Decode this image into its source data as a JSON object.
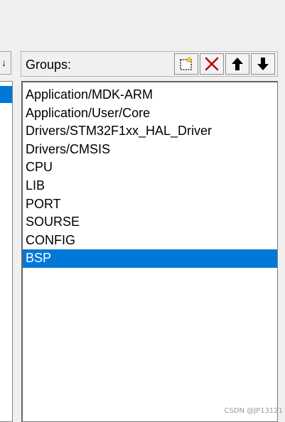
{
  "groups_panel": {
    "label": "Groups:",
    "toolbar": [
      {
        "id": "new",
        "icon": "new-group-icon",
        "tooltip": ""
      },
      {
        "id": "delete",
        "icon": "delete-icon",
        "color": "#c00000"
      },
      {
        "id": "up",
        "icon": "move-up-arrow-icon"
      },
      {
        "id": "down",
        "icon": "move-down-arrow-icon"
      }
    ],
    "items": [
      "Application/MDK-ARM",
      "Application/User/Core",
      "Drivers/STM32F1xx_HAL_Driver",
      "Drivers/CMSIS",
      "CPU",
      "LIB",
      "PORT",
      "SOURSE",
      "CONFIG",
      "BSP"
    ],
    "selected_item": "BSP",
    "selection_color": "#0078d7"
  },
  "watermark": "CSDN @JP13121"
}
